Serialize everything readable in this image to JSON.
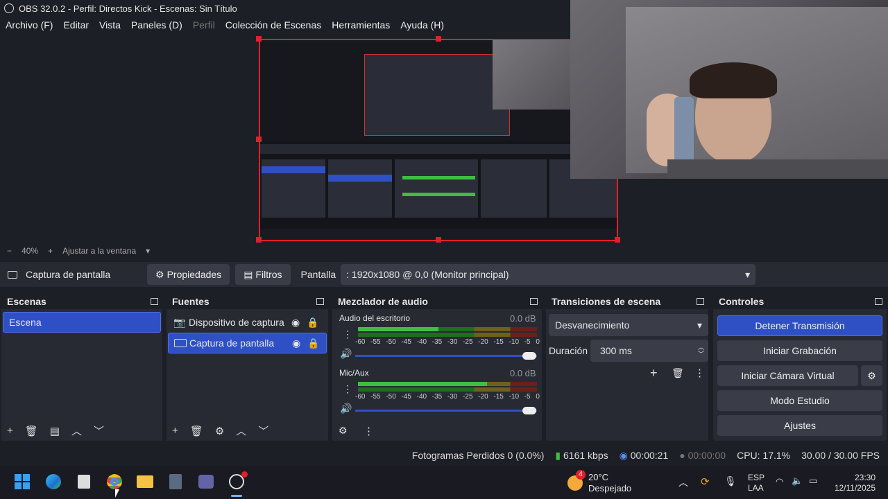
{
  "window": {
    "title": "OBS 32.0.2 - Perfil: Directos Kick - Escenas: Sin Título"
  },
  "menu": {
    "items": [
      "Archivo (F)",
      "Editar",
      "Vista",
      "Paneles (D)",
      "Perfil",
      "Colección de Escenas",
      "Herramientas",
      "Ayuda (H)"
    ]
  },
  "zoom": {
    "minus": "−",
    "value": "40%",
    "plus": "+",
    "fit": "Ajustar a la ventana"
  },
  "source_bar": {
    "selected_source": "Captura de pantalla",
    "properties": "Propiedades",
    "filters": "Filtros",
    "display_label": "Pantalla",
    "display_value": ": 1920x1080 @ 0,0 (Monitor principal)"
  },
  "scenes": {
    "title": "Escenas",
    "items": [
      "Escena"
    ]
  },
  "sources": {
    "title": "Fuentes",
    "items": [
      "Dispositivo de captura d",
      "Captura de pantalla"
    ]
  },
  "mixer": {
    "title": "Mezclador de audio",
    "channels": [
      {
        "name": "Audio del escritorio",
        "db": "0.0 dB",
        "level": 0.45
      },
      {
        "name": "Mic/Aux",
        "db": "0.0 dB",
        "level": 0.72
      }
    ],
    "ticks": [
      "-60",
      "-55",
      "-50",
      "-45",
      "-40",
      "-35",
      "-30",
      "-25",
      "-20",
      "-15",
      "-10",
      "-5",
      "0"
    ]
  },
  "transitions": {
    "title": "Transiciones de escena",
    "selected": "Desvanecimiento",
    "duration_label": "Duración",
    "duration_value": "300 ms"
  },
  "controls": {
    "title": "Controles",
    "stop_stream": "Detener Transmisión",
    "start_recording": "Iniciar Grabación",
    "virtual_cam": "Iniciar Cámara Virtual",
    "studio_mode": "Modo Estudio",
    "settings": "Ajustes"
  },
  "status": {
    "dropped": "Fotogramas Perdidos 0 (0.0%)",
    "bitrate": "6161 kbps",
    "stream_time": "00:00:21",
    "rec_time": "00:00:00",
    "cpu": "CPU: 17.1%",
    "fps": "30.00 / 30.00 FPS"
  },
  "taskbar": {
    "weather_temp": "20°C",
    "weather_desc": "Despejado",
    "weather_badge": "4",
    "lang1": "ESP",
    "lang2": "LAA",
    "time": "23:30",
    "date": "12/11/2025"
  },
  "colors": {
    "accent": "#2f50c5",
    "selection_red": "#e0202a",
    "meter_green": "#3fbf3f",
    "meter_yellow": "#c8b62a",
    "meter_red": "#c83a2a"
  }
}
